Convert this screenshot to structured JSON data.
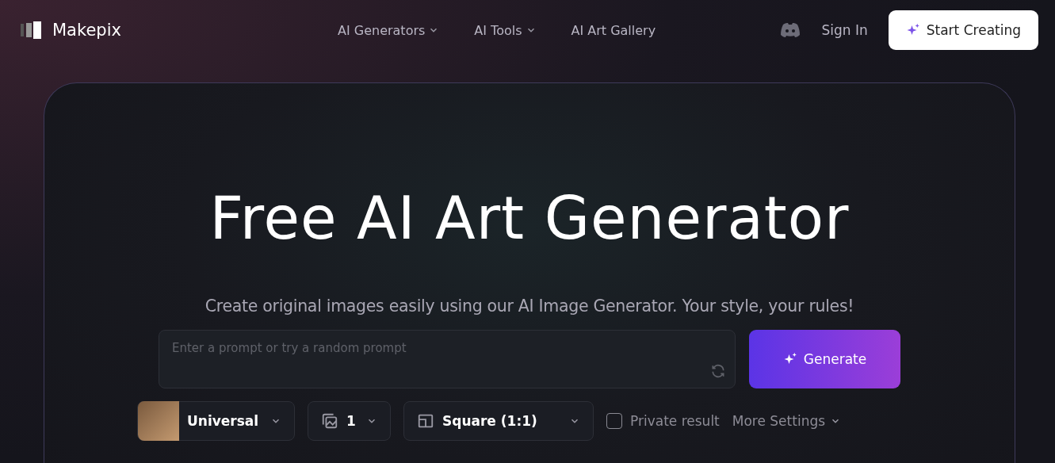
{
  "header": {
    "logo": "Makepix",
    "nav": [
      {
        "label": "AI Generators",
        "dropdown": true
      },
      {
        "label": "AI Tools",
        "dropdown": true
      },
      {
        "label": "AI Art Gallery",
        "dropdown": false
      }
    ],
    "sign_in": "Sign In",
    "cta": "Start Creating"
  },
  "hero": {
    "title": "Free AI Art Generator",
    "subtitle": "Create original images easily using our AI Image Generator. Your style, your rules!",
    "prompt": {
      "placeholder": "Enter a prompt or try a random prompt"
    },
    "generate": "Generate",
    "options": {
      "model": "Universal",
      "count": "1",
      "ratio": "Square (1:1)",
      "private": {
        "label": "Private result",
        "checked": false
      },
      "more": "More Settings"
    }
  }
}
